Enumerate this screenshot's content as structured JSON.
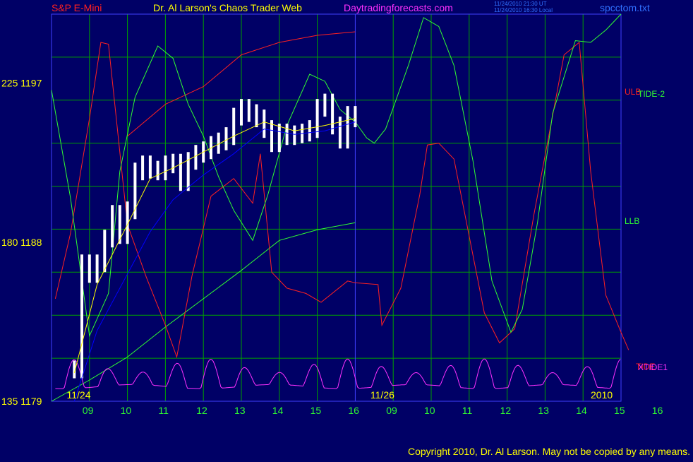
{
  "header": {
    "instrument": "S&P E-Mini",
    "title": "Dr. Al Larson's Chaos Trader Web",
    "site": "Daytradingforecasts.com",
    "timestamp_ut": "11/24/2010 21:30 UT",
    "timestamp_local": "11/24/2010 16:30 Local",
    "filename": "spcctom.txt"
  },
  "footer": {
    "copyright": "Copyright 2010, Dr. Al Larson. May not be copied by any means."
  },
  "colors": {
    "background": "#000066",
    "grid": "#00a000",
    "frame": "#4040ff",
    "price_bars": "#ffffff",
    "down_bars": "#ff0000",
    "ma_fast": "#ffff00",
    "ma_slow": "#0000ff",
    "red_line": "#ff2020",
    "green_line": "#30ff30",
    "magenta_line": "#ff30ff",
    "label_yellow": "#ffff00",
    "title_red": "#ff2020",
    "title_yellow": "#ffff00",
    "title_magenta": "#ff30ff",
    "title_blue": "#3070ff"
  },
  "chart_data": {
    "type": "line",
    "y_axis_labels": [
      {
        "tide": "225",
        "price": "1197",
        "value": 1197
      },
      {
        "tide": "180",
        "price": "1188",
        "value": 1188
      },
      {
        "tide": "135",
        "price": "1179",
        "value": 1179
      }
    ],
    "ylim": [
      1179,
      1200.9
    ],
    "date_labels": [
      "11/24",
      "11/26",
      "2010"
    ],
    "x_ticks": [
      "09",
      "10",
      "11",
      "12",
      "13",
      "14",
      "15",
      "16",
      "09",
      "10",
      "11",
      "12",
      "13",
      "14",
      "15",
      "16"
    ],
    "series_labels": [
      {
        "name": "ULB",
        "color": "#ff2020"
      },
      {
        "name": "TIDE-2",
        "color": "#30ff30"
      },
      {
        "name": "LLB",
        "color": "#30ff30"
      },
      {
        "name": "TIDE",
        "color": "#ff2020"
      },
      {
        "name": "XTIDE1",
        "color": "#ff30ff"
      }
    ],
    "price_series": {
      "x": [
        8.6,
        8.8,
        9.0,
        9.2,
        9.4,
        9.6,
        9.8,
        10.0,
        10.2,
        10.4,
        10.6,
        10.8,
        11.0,
        11.2,
        11.4,
        11.6,
        11.8,
        12.0,
        12.2,
        12.4,
        12.6,
        12.8,
        13.0,
        13.2,
        13.4,
        13.6,
        13.8,
        14.0,
        14.2,
        14.4,
        14.6,
        14.8,
        15.0,
        15.2,
        15.4,
        15.6,
        15.8,
        16.0
      ],
      "close": [
        1180.8,
        1186.8,
        1186.2,
        1186.8,
        1188.2,
        1189.6,
        1188.4,
        1189.8,
        1192.0,
        1192.4,
        1192.1,
        1192.0,
        1192.4,
        1192.5,
        1191.4,
        1192.6,
        1193.0,
        1193.2,
        1193.5,
        1193.7,
        1194.0,
        1195.1,
        1195.6,
        1195.3,
        1195.0,
        1194.4,
        1193.6,
        1194.2,
        1194.0,
        1194.1,
        1194.2,
        1194.4,
        1195.6,
        1195.9,
        1194.6,
        1193.8,
        1195.2,
        1195.0
      ]
    },
    "moving_averages": [
      {
        "color": "yellow",
        "x": [
          8.6,
          9.2,
          10.0,
          10.6,
          11.2,
          12.0,
          12.8,
          13.6,
          14.4,
          15.2,
          16.0
        ],
        "y": [
          1180.6,
          1185.6,
          1189.0,
          1191.6,
          1192.2,
          1193.1,
          1194.0,
          1194.8,
          1194.3,
          1194.6,
          1195.0
        ]
      },
      {
        "color": "blue",
        "x": [
          8.6,
          9.2,
          10.0,
          10.6,
          11.2,
          12.0,
          12.8,
          13.6,
          14.4,
          15.2,
          16.0
        ],
        "y": [
          1179.0,
          1183.0,
          1186.2,
          1188.6,
          1190.4,
          1191.8,
          1193.0,
          1194.4,
          1194.1,
          1194.3,
          1194.8
        ]
      }
    ],
    "red_line": {
      "x": [
        8.1,
        8.5,
        9.0,
        9.3,
        9.5,
        10.0,
        10.5,
        11.0,
        11.3,
        11.7,
        12.2,
        12.8,
        13.3,
        13.5,
        13.8,
        14.2,
        14.7,
        15.1,
        15.8,
        16.0,
        16.6,
        16.7,
        17.2,
        17.7,
        17.9,
        18.2,
        18.6,
        19.4,
        19.8,
        20.2,
        20.7,
        21.5,
        21.9,
        22.2,
        22.6,
        23.0,
        23.2
      ],
      "y": [
        1184.8,
        1188.5,
        1195.0,
        1199.3,
        1199.2,
        1189.0,
        1186.0,
        1183.3,
        1181.5,
        1186.1,
        1190.6,
        1191.6,
        1190.2,
        1193.0,
        1186.3,
        1185.4,
        1185.1,
        1184.6,
        1185.8,
        1185.7,
        1185.6,
        1183.3,
        1185.4,
        1190.7,
        1193.5,
        1193.6,
        1192.7,
        1184.0,
        1182.3,
        1183.1,
        1189.5,
        1198.6,
        1199.3,
        1192.0,
        1185.0,
        1182.9,
        1181.9
      ]
    },
    "green_line": {
      "x": [
        8.0,
        8.5,
        9.0,
        9.5,
        9.8,
        10.2,
        10.8,
        11.2,
        11.6,
        12.0,
        12.4,
        12.8,
        13.3,
        13.7,
        14.2,
        14.8,
        15.2,
        15.6,
        16.0,
        16.3,
        16.5,
        16.8,
        17.4,
        17.8,
        18.2,
        18.6,
        19.1,
        19.6,
        20.1,
        20.4,
        20.8,
        21.2,
        21.8,
        22.2,
        22.6,
        23.0
      ],
      "y": [
        1196.6,
        1190.5,
        1182.7,
        1185.1,
        1192.0,
        1196.2,
        1199.1,
        1198.4,
        1195.8,
        1194.0,
        1191.7,
        1189.8,
        1188.1,
        1190.7,
        1194.6,
        1197.5,
        1197.1,
        1195.5,
        1194.8,
        1193.9,
        1193.6,
        1194.4,
        1198.0,
        1200.7,
        1200.2,
        1198.0,
        1192.6,
        1185.8,
        1182.9,
        1184.2,
        1189.1,
        1195.3,
        1199.4,
        1199.3,
        1200.0,
        1200.9
      ]
    },
    "upper_band": {
      "x": [
        10.0,
        11.0,
        12.0,
        13.0,
        14.0,
        15.0,
        16.0
      ],
      "y": [
        1194.0,
        1195.8,
        1196.8,
        1198.6,
        1199.3,
        1199.7,
        1199.9
      ]
    },
    "lower_band": {
      "x": [
        8.0,
        9.0,
        10.0,
        11.0,
        12.0,
        13.0,
        14.0,
        15.0,
        16.0
      ],
      "y": [
        1179.0,
        1180.2,
        1181.5,
        1183.2,
        1184.8,
        1186.4,
        1188.1,
        1188.7,
        1189.1
      ]
    },
    "magenta_line": {
      "period": 0.9,
      "base": 1180.1,
      "amplitude": 1.3,
      "x_range": [
        8.1,
        23.0
      ]
    }
  }
}
